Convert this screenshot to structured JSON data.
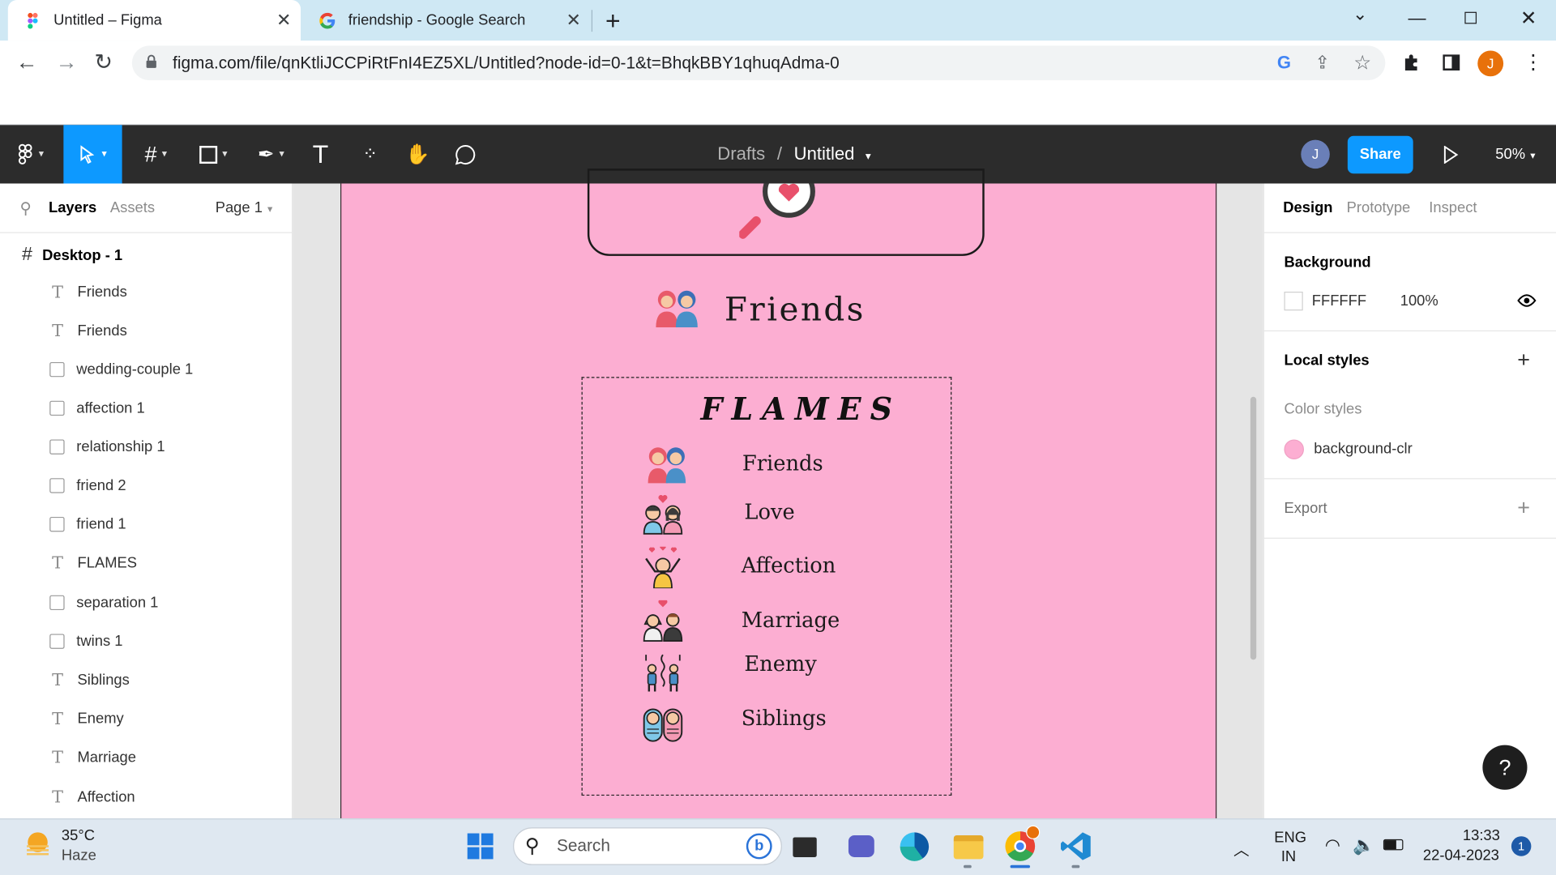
{
  "browser": {
    "tabs": [
      {
        "title": "Untitled – Figma",
        "active": true
      },
      {
        "title": "friendship - Google Search",
        "active": false
      }
    ],
    "url": "figma.com/file/qnKtliJCCPiRtFnI4EZ5XL/Untitled?node-id=0-1&t=BhqkBBY1qhuqAdma-0",
    "profile_initial": "J"
  },
  "figma": {
    "breadcrumb_folder": "Drafts",
    "breadcrumb_sep": "/",
    "file_name": "Untitled",
    "user_initial": "J",
    "share_label": "Share",
    "zoom": "50%",
    "left_tabs": {
      "layers": "Layers",
      "assets": "Assets",
      "page": "Page 1"
    },
    "frame_name": "Desktop - 1",
    "layers": [
      {
        "name": "Friends",
        "kind": "text"
      },
      {
        "name": "Friends",
        "kind": "text"
      },
      {
        "name": "wedding-couple 1",
        "kind": "image"
      },
      {
        "name": "affection 1",
        "kind": "image"
      },
      {
        "name": "relationship 1",
        "kind": "image"
      },
      {
        "name": "friend 2",
        "kind": "image"
      },
      {
        "name": "friend 1",
        "kind": "image"
      },
      {
        "name": "FLAMES",
        "kind": "text"
      },
      {
        "name": "separation 1",
        "kind": "image"
      },
      {
        "name": "twins 1",
        "kind": "image"
      },
      {
        "name": "Siblings",
        "kind": "text"
      },
      {
        "name": "Enemy",
        "kind": "text"
      },
      {
        "name": "Marriage",
        "kind": "text"
      },
      {
        "name": "Affection",
        "kind": "text"
      }
    ],
    "right_tabs": {
      "design": "Design",
      "prototype": "Prototype",
      "inspect": "Inspect"
    },
    "background": {
      "title": "Background",
      "hex": "FFFFFF",
      "opacity": "100%"
    },
    "local_styles": "Local styles",
    "color_styles": "Color styles",
    "color_style_name": "background-clr",
    "export": "Export",
    "help": "?"
  },
  "artboard": {
    "heading": "Friends",
    "flames_title": "FLAMES",
    "items": [
      {
        "label": "Friends",
        "icon": "friends-icon"
      },
      {
        "label": "Love",
        "icon": "love-couple-icon"
      },
      {
        "label": "Affection",
        "icon": "affection-icon"
      },
      {
        "label": "Marriage",
        "icon": "wedding-couple-icon"
      },
      {
        "label": "Enemy",
        "icon": "separation-icon"
      },
      {
        "label": "Siblings",
        "icon": "twins-icon"
      }
    ],
    "colors": {
      "background": "#fcaed2"
    }
  },
  "taskbar": {
    "temperature": "35°C",
    "weather": "Haze",
    "search_placeholder": "Search",
    "language": "ENG",
    "region": "IN",
    "time": "13:33",
    "date": "22-04-2023",
    "notification_count": "1"
  }
}
